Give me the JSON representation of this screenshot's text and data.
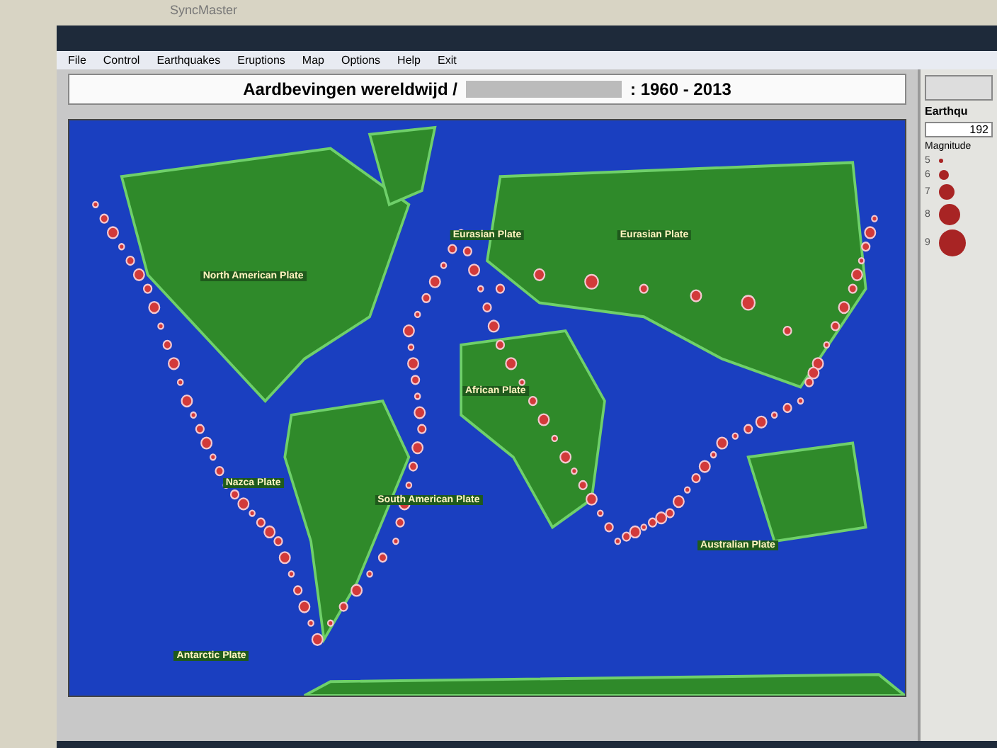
{
  "monitor": {
    "brand": "SyncMaster"
  },
  "menu": [
    "File",
    "Control",
    "Earthquakes",
    "Eruptions",
    "Map",
    "Options",
    "Help",
    "Exit"
  ],
  "title": {
    "prefix": "Aardbevingen wereldwijd /",
    "suffix": ": 1960 - 2013"
  },
  "map": {
    "plates": [
      "North American Plate",
      "Eurasian Plate",
      "Eurasian Plate",
      "African Plate",
      "South American Plate",
      "Nazca Plate",
      "Australian Plate",
      "Antarctic Plate"
    ]
  },
  "panel": {
    "heading": "Earthqu",
    "field_value": "192",
    "legend_title": "Magnitude",
    "magnitudes": [
      "5",
      "6",
      "7",
      "8",
      "9"
    ]
  }
}
